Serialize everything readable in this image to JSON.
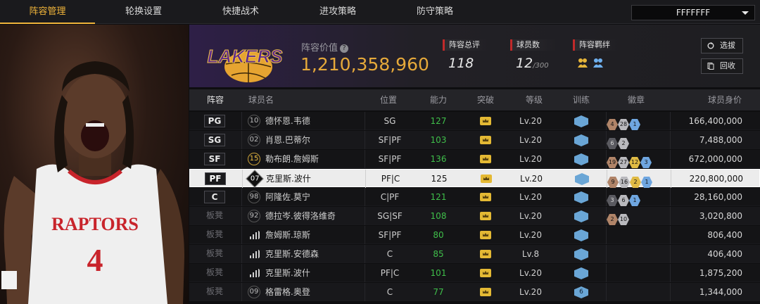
{
  "tabs": [
    {
      "label": "阵容管理",
      "active": true
    },
    {
      "label": "轮换设置",
      "active": false
    },
    {
      "label": "快捷战术",
      "active": false
    },
    {
      "label": "进攻策略",
      "active": false
    },
    {
      "label": "防守策略",
      "active": false
    }
  ],
  "team_select": {
    "value": "FFFFFFF",
    "icon": "chevron-down-icon"
  },
  "team": {
    "logo_text": "LAKERS",
    "value_label": "阵容价值",
    "value": "1,210,358,960",
    "rating_label": "阵容总评",
    "rating": "118",
    "count_label": "球员数",
    "count": "12",
    "count_max": "/300",
    "bond_label": "阵容羁绊"
  },
  "buttons": {
    "select": "选拔",
    "recycle": "回收"
  },
  "columns": {
    "lineup": "阵容",
    "name": "球员名",
    "position": "位置",
    "ability": "能力",
    "breakthrough": "突破",
    "level": "等级",
    "training": "训练",
    "badges": "徽章",
    "worth": "球员身价"
  },
  "players": [
    {
      "slot": "PG",
      "number": "10",
      "num_style": "plain",
      "name": "德怀恩.韦德",
      "position": "SG",
      "ability": "127",
      "level": "Lv.20",
      "training": "",
      "badges": [
        {
          "v": "4",
          "c": "bronze"
        },
        {
          "v": "28",
          "c": "silver"
        },
        {
          "v": "1",
          "c": "blue"
        }
      ],
      "worth": "166,400,000"
    },
    {
      "slot": "SG",
      "number": "02",
      "num_style": "plain",
      "name": "肖恩.巴蒂尔",
      "position": "SF|PF",
      "ability": "103",
      "level": "Lv.20",
      "training": "",
      "badges": [
        {
          "v": "6",
          "c": "dark"
        },
        {
          "v": "2",
          "c": "silver"
        }
      ],
      "worth": "7,488,000"
    },
    {
      "slot": "SF",
      "number": "15",
      "num_style": "gold",
      "name": "勒布朗.詹姆斯",
      "position": "SF|PF",
      "ability": "136",
      "level": "Lv.20",
      "training": "",
      "badges": [
        {
          "v": "19",
          "c": "bronze"
        },
        {
          "v": "27",
          "c": "silver"
        },
        {
          "v": "12",
          "c": "gold"
        },
        {
          "v": "3",
          "c": "blue"
        }
      ],
      "worth": "672,000,000"
    },
    {
      "slot": "PF",
      "number": "07",
      "num_style": "dia",
      "name": "克里斯.波什",
      "position": "PF|C",
      "ability": "125",
      "level": "Lv.20",
      "training": "",
      "badges": [
        {
          "v": "9",
          "c": "bronze"
        },
        {
          "v": "16",
          "c": "silver"
        },
        {
          "v": "2",
          "c": "gold"
        },
        {
          "v": "1",
          "c": "blue"
        }
      ],
      "worth": "220,800,000",
      "selected": true
    },
    {
      "slot": "C",
      "number": "98",
      "num_style": "plain",
      "name": "阿隆佐.莫宁",
      "position": "C|PF",
      "ability": "121",
      "level": "Lv.20",
      "training": "",
      "badges": [
        {
          "v": "3",
          "c": "dark"
        },
        {
          "v": "6",
          "c": "silver"
        },
        {
          "v": "1",
          "c": "blue"
        }
      ],
      "worth": "28,160,000"
    },
    {
      "slot": "板凳",
      "number": "92",
      "num_style": "plain",
      "name": "德拉岑.彼得洛维奇",
      "position": "SG|SF",
      "ability": "108",
      "level": "Lv.20",
      "training": "",
      "badges": [
        {
          "v": "2",
          "c": "bronze"
        },
        {
          "v": "10",
          "c": "silver"
        }
      ],
      "worth": "3,020,800"
    },
    {
      "slot": "板凳",
      "number": "",
      "num_style": "bars",
      "name": "詹姆斯.琼斯",
      "position": "SF|PF",
      "ability": "80",
      "level": "Lv.20",
      "training": "",
      "badges": [],
      "worth": "806,400"
    },
    {
      "slot": "板凳",
      "number": "",
      "num_style": "bars",
      "name": "克里斯.安德森",
      "position": "C",
      "ability": "85",
      "level": "Lv.8",
      "training": "",
      "badges": [],
      "worth": "406,400"
    },
    {
      "slot": "板凳",
      "number": "",
      "num_style": "bars",
      "name": "克里斯.波什",
      "position": "PF|C",
      "ability": "101",
      "level": "Lv.20",
      "training": "",
      "badges": [],
      "worth": "1,875,200"
    },
    {
      "slot": "板凳",
      "number": "09",
      "num_style": "plain",
      "name": "格雷格.奥登",
      "position": "C",
      "ability": "77",
      "level": "Lv.20",
      "training": "6",
      "badges": [],
      "worth": "1,344,000"
    }
  ],
  "portrait": {
    "jersey_text": "RAPTORS",
    "jersey_number": "4"
  },
  "colors": {
    "accent": "#f0b43a",
    "value": "#e6a93a",
    "ability": "#3fbf4a",
    "lakers_purple": "#552583"
  }
}
